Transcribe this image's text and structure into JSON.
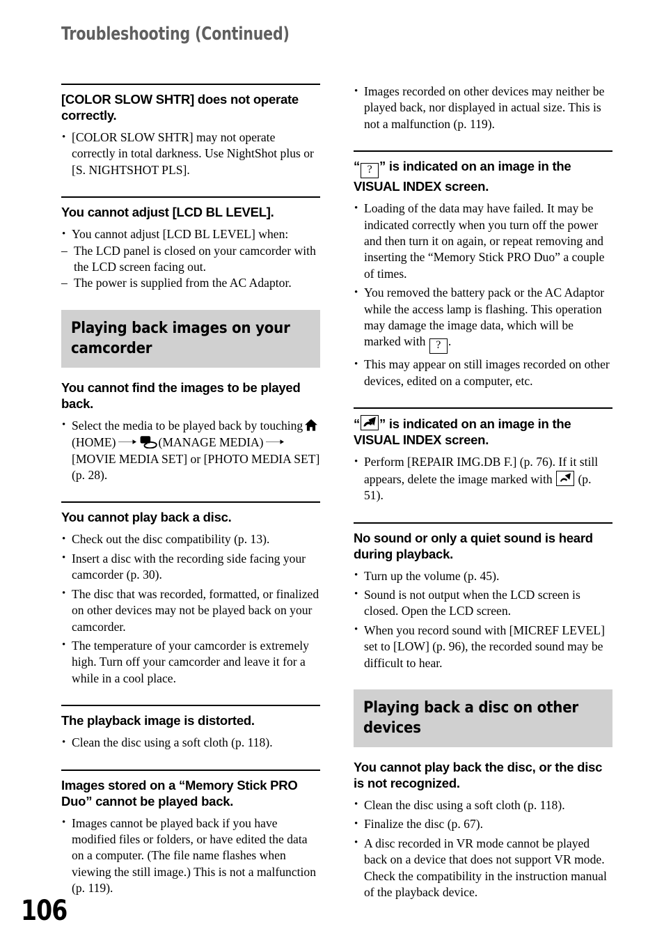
{
  "header": {
    "title": "Troubleshooting (Continued)"
  },
  "folio": {
    "page_number": "106"
  },
  "left_column": {
    "blocks": [
      {
        "type": "qa",
        "heading": "[COLOR SLOW SHTR] does not operate correctly.",
        "bullets": [
          "[COLOR SLOW SHTR] may not operate correctly in total darkness. Use NightShot plus or [S. NIGHTSHOT PLS]."
        ]
      },
      {
        "type": "qa",
        "heading": "You cannot adjust [LCD BL LEVEL].",
        "bullets": [
          "You cannot adjust [LCD BL LEVEL] when:"
        ],
        "dashes": [
          "The LCD panel is closed on your camcorder with the LCD screen facing out.",
          "The power is supplied from the AC Adaptor."
        ]
      },
      {
        "type": "banner",
        "banner": "Playing back images on your camcorder"
      },
      {
        "type": "qa-nobar",
        "heading": "You cannot find the images to be played back.",
        "bullet_icons": {
          "pre_text": "Select the media to be played back by touching",
          "home_label": "(HOME)",
          "manage_media_label": "(MANAGE MEDIA)",
          "post_text": "[MOVIE MEDIA SET] or [PHOTO MEDIA SET] (p. 28)."
        }
      },
      {
        "type": "qa",
        "heading": "You cannot play back a disc.",
        "bullets": [
          "Check out the disc compatibility (p. 13).",
          "Insert a disc with the recording side facing your camcorder (p. 30).",
          "The disc that was recorded, formatted, or finalized on other devices may not be played back on your camcorder.",
          "The temperature of your camcorder is extremely high. Turn off your camcorder and leave it for a while in a cool place."
        ]
      },
      {
        "type": "qa",
        "heading": "The playback image is distorted.",
        "bullets": [
          "Clean the disc using a soft cloth (p. 118)."
        ]
      },
      {
        "type": "qa",
        "heading": "Images stored on a “Memory Stick PRO Duo” cannot be played back.",
        "bullets": [
          "Images cannot be played back if you have modified files or folders, or have edited the data on a computer. (The file name flashes when viewing the still image.) This is not a malfunction (p. 119)."
        ]
      }
    ]
  },
  "right_column": {
    "lead_bullets": [
      "Images recorded on other devices may neither be played back, nor displayed in actual size. This is not a malfunction (p. 119)."
    ],
    "blocks": [
      {
        "type": "qa-icon-head",
        "heading_icon": "question-box-icon",
        "heading_prefix": "“",
        "heading_suffix": "” is indicated on an image in the VISUAL INDEX screen.",
        "bullets": [
          "Loading of the data may have failed. It may be indicated correctly when you turn off the power and then turn it on again, or repeat removing and inserting the “Memory Stick PRO Duo” a couple of times.",
          "This may appear on still images recorded on other devices, edited on a computer, etc."
        ],
        "bullet_with_icon": {
          "pre_text": "You removed the battery pack or the AC Adaptor while the access lamp is flashing. This operation may damage the image data, which will be marked with",
          "post_text": "."
        }
      },
      {
        "type": "qa-icon-head-2",
        "heading_icon": "repair-arrow-box-icon",
        "heading_prefix": "“",
        "heading_suffix": "” is indicated on an image in the VISUAL INDEX screen.",
        "bullet_with_icon": {
          "pre_text": "Perform [REPAIR IMG.DB F.] (p. 76). If it still appears, delete the image marked with",
          "post_text": "(p. 51)."
        }
      },
      {
        "type": "qa",
        "heading": "No sound or only a quiet sound is heard during playback.",
        "bullets": [
          "Turn up the volume (p. 45).",
          "Sound is not output when the LCD screen is closed. Open the LCD screen.",
          "When you record sound with [MICREF LEVEL] set to [LOW] (p. 96), the recorded sound may be difficult to hear."
        ]
      },
      {
        "type": "banner",
        "banner": "Playing back a disc on other devices"
      },
      {
        "type": "qa-nobar",
        "heading": "You cannot play back the disc, or the disc is not recognized.",
        "bullets": [
          "Clean the disc using a soft cloth (p. 118).",
          "Finalize the disc (p. 67).",
          "A disc recorded in VR mode cannot be played back on a device that does not support VR mode. Check the compatibility in the instruction manual of the playback device."
        ]
      }
    ]
  },
  "colors": {
    "banner_bg": "#d0d0d0",
    "header_text": "#5f5f5f",
    "body_text": "#000000"
  }
}
